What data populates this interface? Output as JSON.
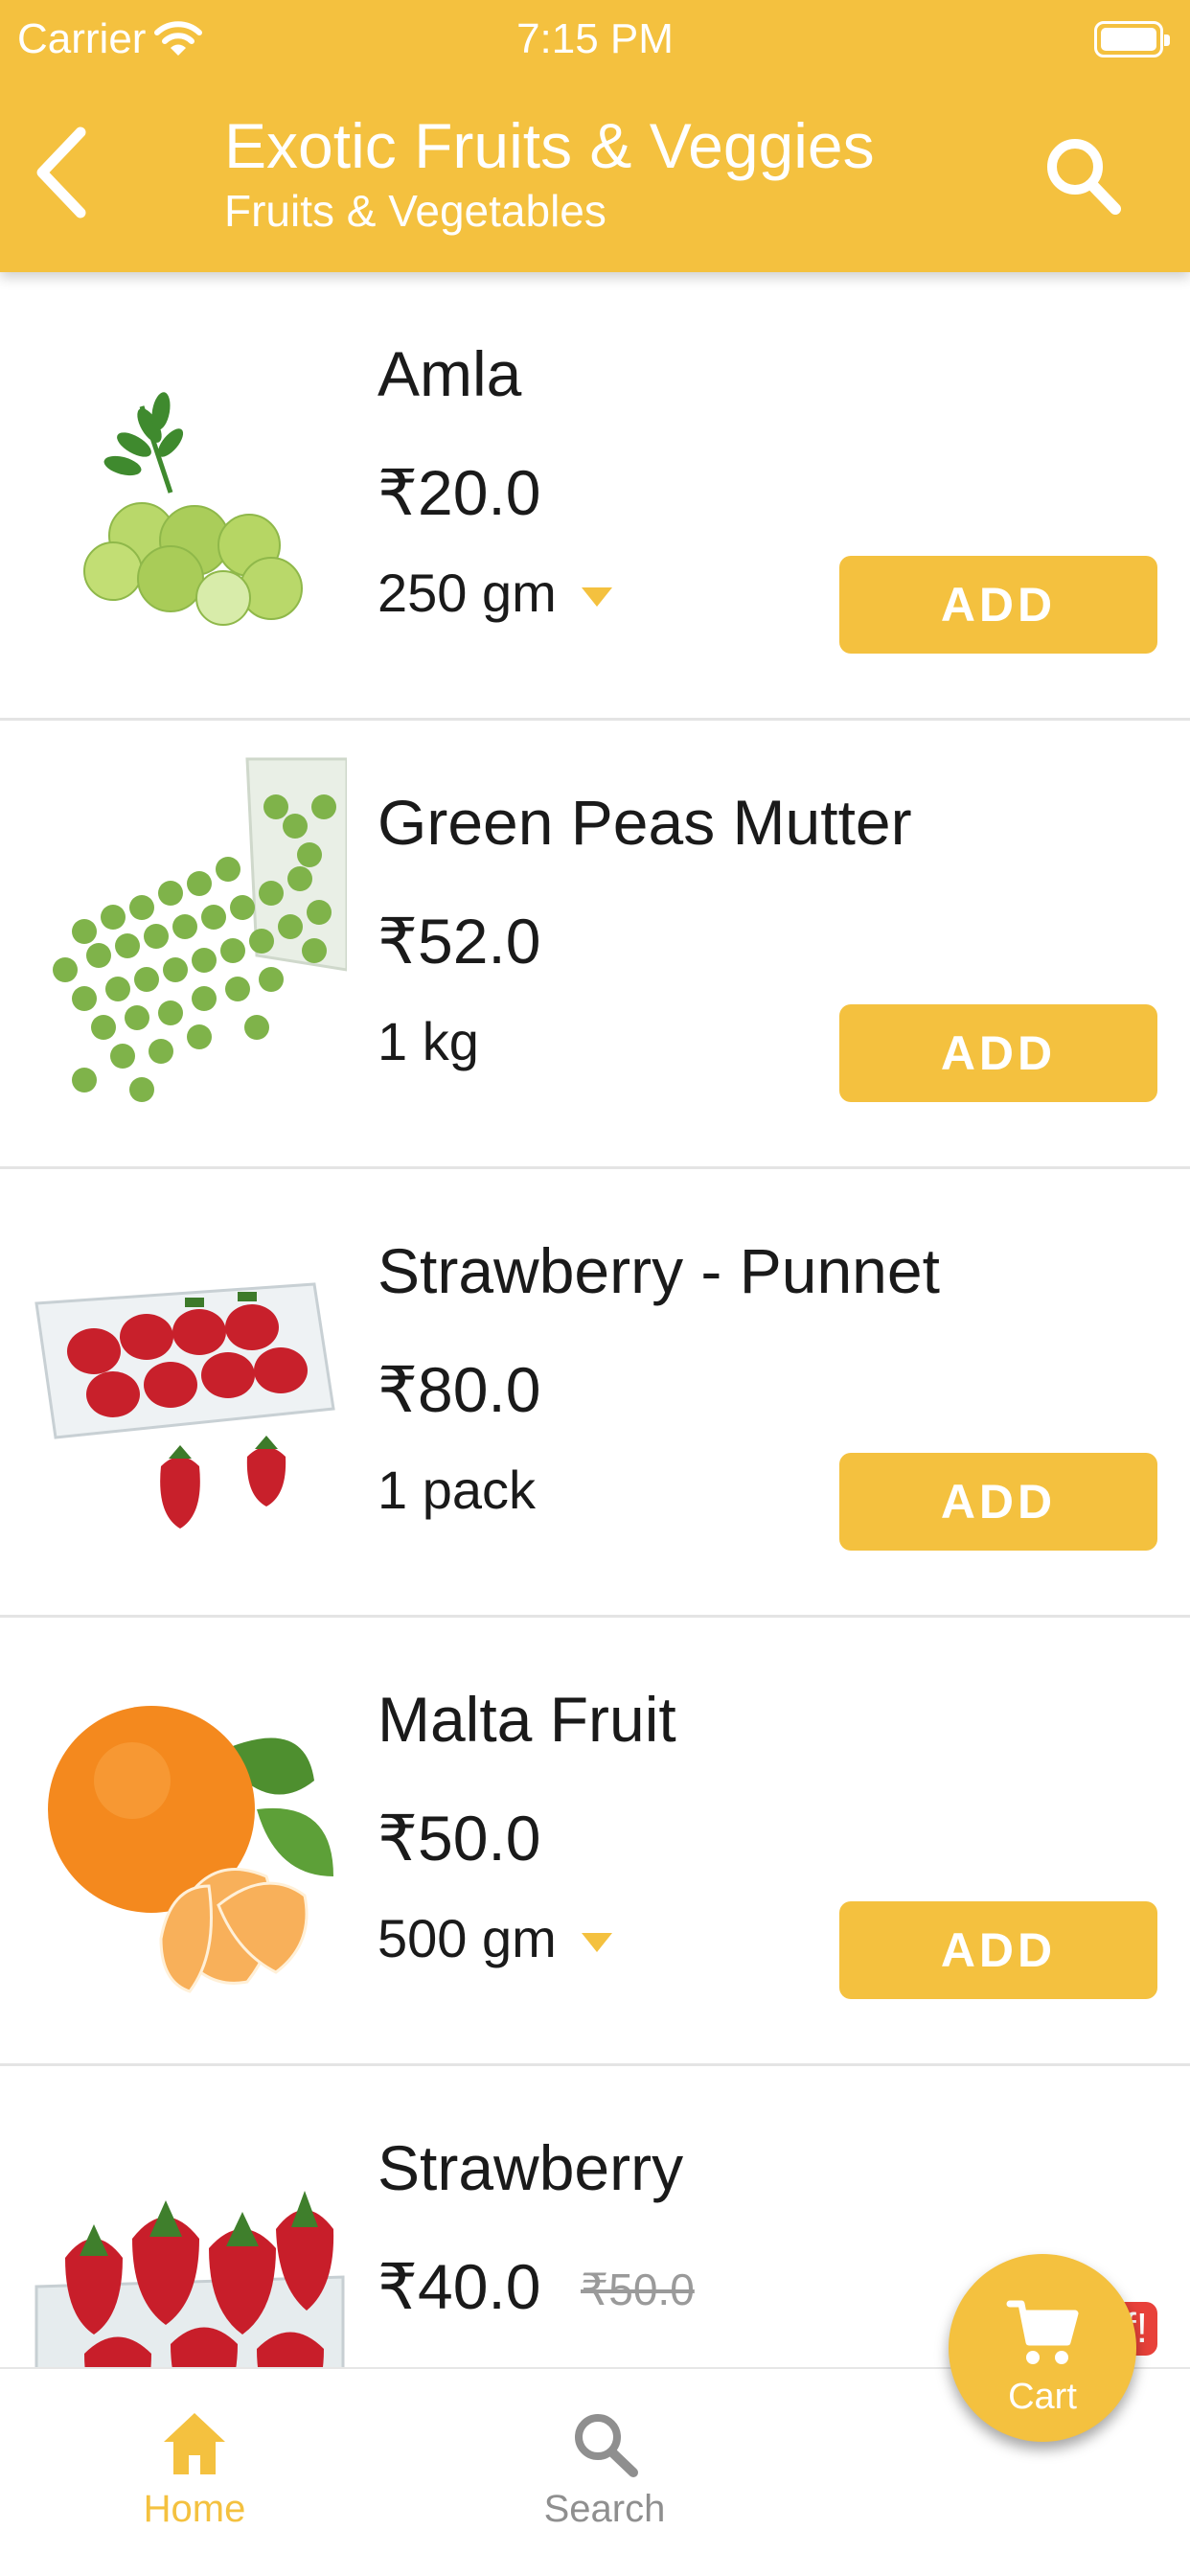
{
  "status_bar": {
    "carrier": "Carrier",
    "time": "7:15 PM"
  },
  "header": {
    "title": "Exotic Fruits & Veggies",
    "subtitle": "Fruits & Vegetables"
  },
  "products": [
    {
      "name": "Amla",
      "price": "₹20.0",
      "quantity": "250 gm",
      "has_dropdown": true,
      "add_label": "ADD"
    },
    {
      "name": "Green Peas Mutter",
      "price": "₹52.0",
      "quantity": "1 kg",
      "has_dropdown": false,
      "add_label": "ADD"
    },
    {
      "name": "Strawberry - Punnet",
      "price": "₹80.0",
      "quantity": "1 pack",
      "has_dropdown": false,
      "add_label": "ADD"
    },
    {
      "name": "Malta Fruit",
      "price": "₹50.0",
      "quantity": "500 gm",
      "has_dropdown": true,
      "add_label": "ADD"
    },
    {
      "name": "Strawberry",
      "price": "₹40.0",
      "mrp": "₹50.0",
      "badge": "ff!"
    }
  ],
  "tabbar": {
    "home_label": "Home",
    "search_label": "Search",
    "cart_label": "Cart"
  },
  "colors": {
    "accent": "#F4C13F",
    "badge": "#E8413A",
    "inactive": "#8F8F8F"
  },
  "icons": {
    "back": "back-arrow-icon",
    "search": "search-icon",
    "home": "home-icon",
    "cart": "cart-icon",
    "wifi": "wifi-icon",
    "battery": "battery-icon",
    "dropdown": "dropdown-caret-icon"
  }
}
